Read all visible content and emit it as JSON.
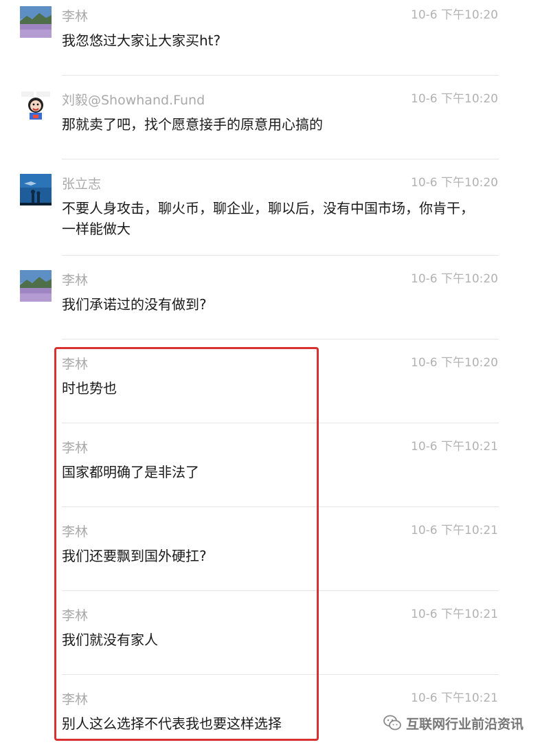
{
  "messages": [
    {
      "name": "李林",
      "time": "10-6 下午10:20",
      "text": "我忽悠过大家让大家买ht?",
      "avatar": "landscape-avatar"
    },
    {
      "name": "刘毅@Showhand.Fund",
      "time": "10-6 下午10:20",
      "text": "那就卖了吧，找个愿意接手的原意用心搞的",
      "avatar": "cartoon-meme-avatar"
    },
    {
      "name": "张立志",
      "time": "10-6 下午10:20",
      "text": "不要人身攻击，聊火币，聊企业，聊以后，没有中国市场，你肯干，一样能做大",
      "avatar": "aquarium-avatar"
    },
    {
      "name": "李林",
      "time": "10-6 下午10:20",
      "text": "我们承诺过的没有做到?",
      "avatar": "landscape-avatar"
    },
    {
      "name": "李林",
      "time": "10-6 下午10:20",
      "text": "时也势也"
    },
    {
      "name": "李林",
      "time": "10-6 下午10:21",
      "text": "国家都明确了是非法了"
    },
    {
      "name": "李林",
      "time": "10-6 下午10:21",
      "text": "我们还要飘到国外硬扛?"
    },
    {
      "name": "李林",
      "time": "10-6 下午10:21",
      "text": "我们就没有家人"
    },
    {
      "name": "李林",
      "time": "10-6 下午10:21",
      "text": "别人这么选择不代表我也要这样选择"
    }
  ],
  "watermark": {
    "text": "互联网行业前沿资讯",
    "icon": "wechat-logo-icon"
  },
  "colors": {
    "highlight": "#d9312f",
    "name": "#a9a9a9",
    "time": "#b2b2b2",
    "text": "#1a1a1a"
  }
}
